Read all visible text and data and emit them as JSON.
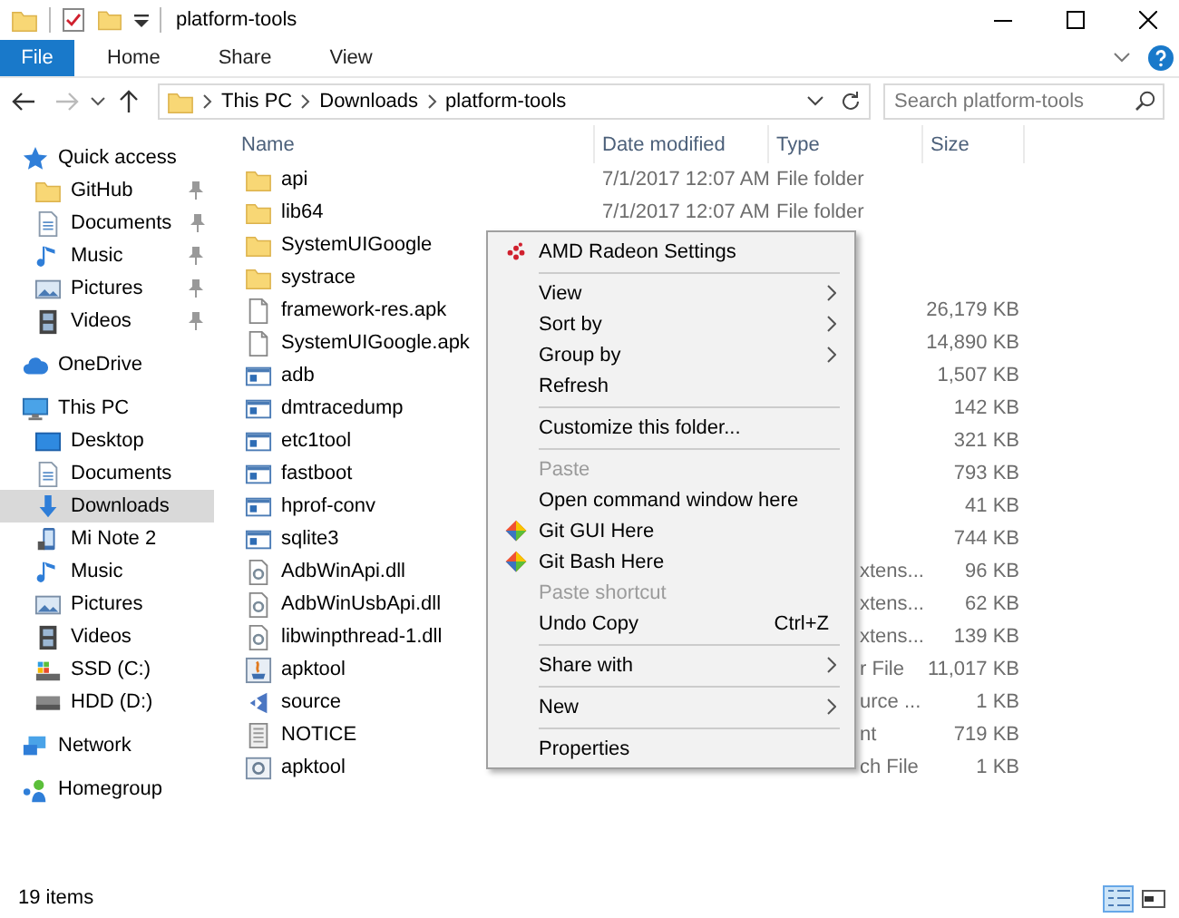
{
  "window": {
    "title": "platform-tools"
  },
  "ribbon": {
    "file_button": "File",
    "tabs": [
      "Home",
      "Share",
      "View"
    ]
  },
  "address": {
    "path": [
      "This PC",
      "Downloads",
      "platform-tools"
    ],
    "search": {
      "placeholder": "Search platform-tools"
    }
  },
  "sidebar": {
    "items": [
      {
        "label": "Quick access",
        "kind": "star",
        "selected": false,
        "children": [
          {
            "label": "GitHub",
            "kind": "folder",
            "pinned": true,
            "selected": false
          },
          {
            "label": "Documents",
            "kind": "docs",
            "pinned": true,
            "selected": false
          },
          {
            "label": "Music",
            "kind": "music",
            "pinned": true,
            "selected": false
          },
          {
            "label": "Pictures",
            "kind": "pictures",
            "pinned": true,
            "selected": false
          },
          {
            "label": "Videos",
            "kind": "videos",
            "pinned": true,
            "selected": false
          }
        ]
      },
      {
        "label": "OneDrive",
        "kind": "cloud",
        "selected": false
      },
      {
        "label": "This PC",
        "kind": "pc",
        "selected": false,
        "children": [
          {
            "label": "Desktop",
            "kind": "desktop",
            "selected": false
          },
          {
            "label": "Documents",
            "kind": "docs",
            "selected": false
          },
          {
            "label": "Downloads",
            "kind": "download",
            "selected": true
          },
          {
            "label": "Mi Note 2",
            "kind": "phone",
            "selected": false
          },
          {
            "label": "Music",
            "kind": "music",
            "selected": false
          },
          {
            "label": "Pictures",
            "kind": "pictures",
            "selected": false
          },
          {
            "label": "Videos",
            "kind": "videos",
            "selected": false
          },
          {
            "label": "SSD (C:)",
            "kind": "ssd",
            "selected": false
          },
          {
            "label": "HDD (D:)",
            "kind": "hdd",
            "selected": false
          }
        ]
      },
      {
        "label": "Network",
        "kind": "network",
        "selected": false
      },
      {
        "label": "Homegroup",
        "kind": "homegroup",
        "selected": false
      }
    ]
  },
  "table": {
    "columns": [
      "Name",
      "Date modified",
      "Type",
      "Size"
    ],
    "rows": [
      {
        "name": "api",
        "kind": "folder",
        "date": "7/1/2017 12:07 AM",
        "type": "File folder"
      },
      {
        "name": "lib64",
        "kind": "folder",
        "date": "7/1/2017 12:07 AM",
        "type": "File folder"
      },
      {
        "name": "SystemUIGoogle",
        "kind": "folder"
      },
      {
        "name": "systrace",
        "kind": "folder"
      },
      {
        "name": "framework-res.apk",
        "kind": "file",
        "size": "26,179 KB"
      },
      {
        "name": "SystemUIGoogle.apk",
        "kind": "file",
        "size": "14,890 KB"
      },
      {
        "name": "adb",
        "kind": "exe",
        "size": "1,507 KB"
      },
      {
        "name": "dmtracedump",
        "kind": "exe",
        "size": "142 KB"
      },
      {
        "name": "etc1tool",
        "kind": "exe",
        "size": "321 KB"
      },
      {
        "name": "fastboot",
        "kind": "exe",
        "size": "793 KB"
      },
      {
        "name": "hprof-conv",
        "kind": "exe",
        "size": "41 KB"
      },
      {
        "name": "sqlite3",
        "kind": "exe",
        "size": "744 KB"
      },
      {
        "name": "AdbWinApi.dll",
        "kind": "dll",
        "type": "xtens...",
        "size": "96 KB"
      },
      {
        "name": "AdbWinUsbApi.dll",
        "kind": "dll",
        "type": "xtens...",
        "size": "62 KB"
      },
      {
        "name": "libwinpthread-1.dll",
        "kind": "dll",
        "type": "xtens...",
        "size": "139 KB"
      },
      {
        "name": "apktool",
        "kind": "jar",
        "type": "r File",
        "size": "11,017 KB"
      },
      {
        "name": "source",
        "kind": "vs",
        "type": "urce ...",
        "size": "1 KB"
      },
      {
        "name": "NOTICE",
        "kind": "text",
        "type": "nt",
        "size": "719 KB"
      },
      {
        "name": "apktool",
        "kind": "bat",
        "type": "ch File",
        "size": "1 KB"
      }
    ]
  },
  "menu": {
    "items": [
      {
        "kind": "amd",
        "label": "AMD Radeon Settings",
        "disabled": false
      },
      {
        "kind": "separator"
      },
      {
        "kind": "item",
        "label": "View",
        "submenu": true,
        "disabled": false
      },
      {
        "kind": "item",
        "label": "Sort by",
        "submenu": true,
        "disabled": false
      },
      {
        "kind": "item",
        "label": "Group by",
        "submenu": true,
        "disabled": false
      },
      {
        "kind": "item",
        "label": "Refresh",
        "disabled": false
      },
      {
        "kind": "separator"
      },
      {
        "kind": "item",
        "label": "Customize this folder...",
        "disabled": false
      },
      {
        "kind": "separator"
      },
      {
        "kind": "item",
        "label": "Paste",
        "disabled": true
      },
      {
        "kind": "item",
        "label": "Open command window here",
        "disabled": false
      },
      {
        "kind": "git",
        "label": "Git GUI Here",
        "disabled": false
      },
      {
        "kind": "git",
        "label": "Git Bash Here",
        "disabled": false
      },
      {
        "kind": "item",
        "label": "Paste shortcut",
        "disabled": true
      },
      {
        "kind": "item",
        "label": "Undo Copy",
        "shortcut": "Ctrl+Z",
        "disabled": false
      },
      {
        "kind": "separator"
      },
      {
        "kind": "item",
        "label": "Share with",
        "submenu": true,
        "disabled": false
      },
      {
        "kind": "separator"
      },
      {
        "kind": "item",
        "label": "New",
        "submenu": true,
        "disabled": false
      },
      {
        "kind": "separator"
      },
      {
        "kind": "item",
        "label": "Properties",
        "disabled": false
      }
    ]
  },
  "status_bar": {
    "text": "19 items",
    "views": [
      {
        "kind": "details",
        "selected": true
      },
      {
        "kind": "large-icons",
        "selected": false
      }
    ]
  }
}
